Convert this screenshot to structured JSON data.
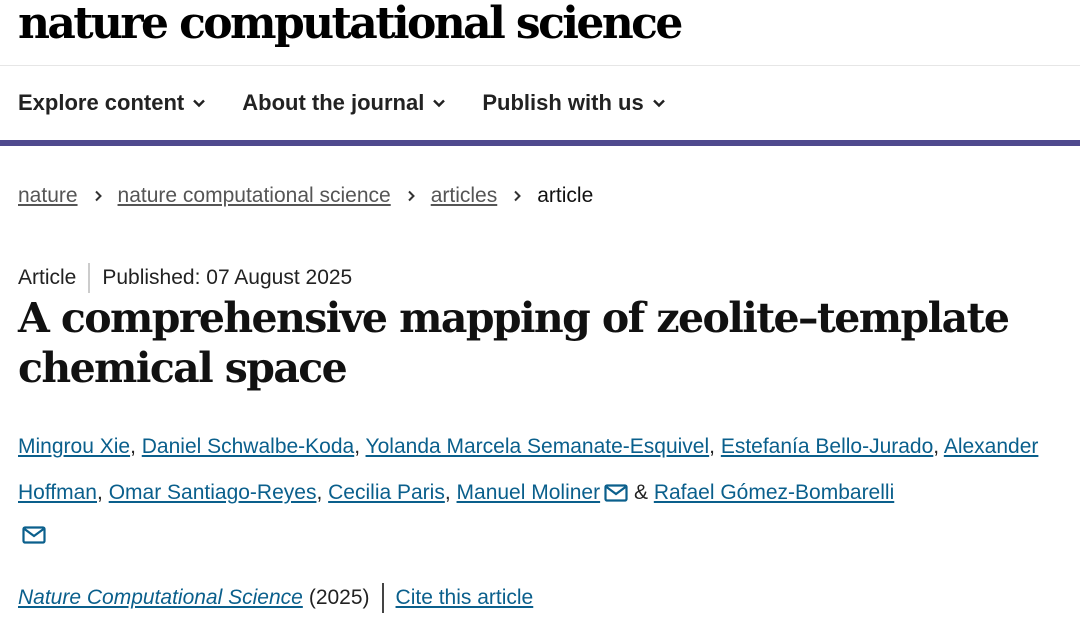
{
  "site": {
    "brand": "nature computational science"
  },
  "nav": {
    "items": [
      {
        "label": "Explore content"
      },
      {
        "label": "About the journal"
      },
      {
        "label": "Publish with us"
      }
    ]
  },
  "breadcrumb": {
    "items": [
      "nature",
      "nature computational science",
      "articles"
    ],
    "current": "article"
  },
  "article": {
    "type": "Article",
    "published": "Published: 07 August 2025",
    "title": "A comprehensive mapping of zeolite–template chemical space",
    "authors": [
      "Mingrou Xie",
      "Daniel Schwalbe-Koda",
      "Yolanda Marcela Semanate-Esquivel",
      "Estefanía Bello-Jurado",
      "Alexander Hoffman",
      "Omar Santiago-Reyes",
      "Cecilia Paris",
      "Manuel Moliner",
      "Rafael Gómez-Bombarelli"
    ],
    "separator": ",",
    "ampersand": "&",
    "journal": "Nature Computational Science",
    "year": "(2025)",
    "cite": "Cite this article"
  },
  "colors": {
    "link": "#0a5f8c",
    "nav_border": "#4f4a8e"
  },
  "icons": {
    "nav_chevron": "chevron-down-icon",
    "crumb_separator": "chevron-right-icon",
    "corresponding": "mail-icon"
  }
}
